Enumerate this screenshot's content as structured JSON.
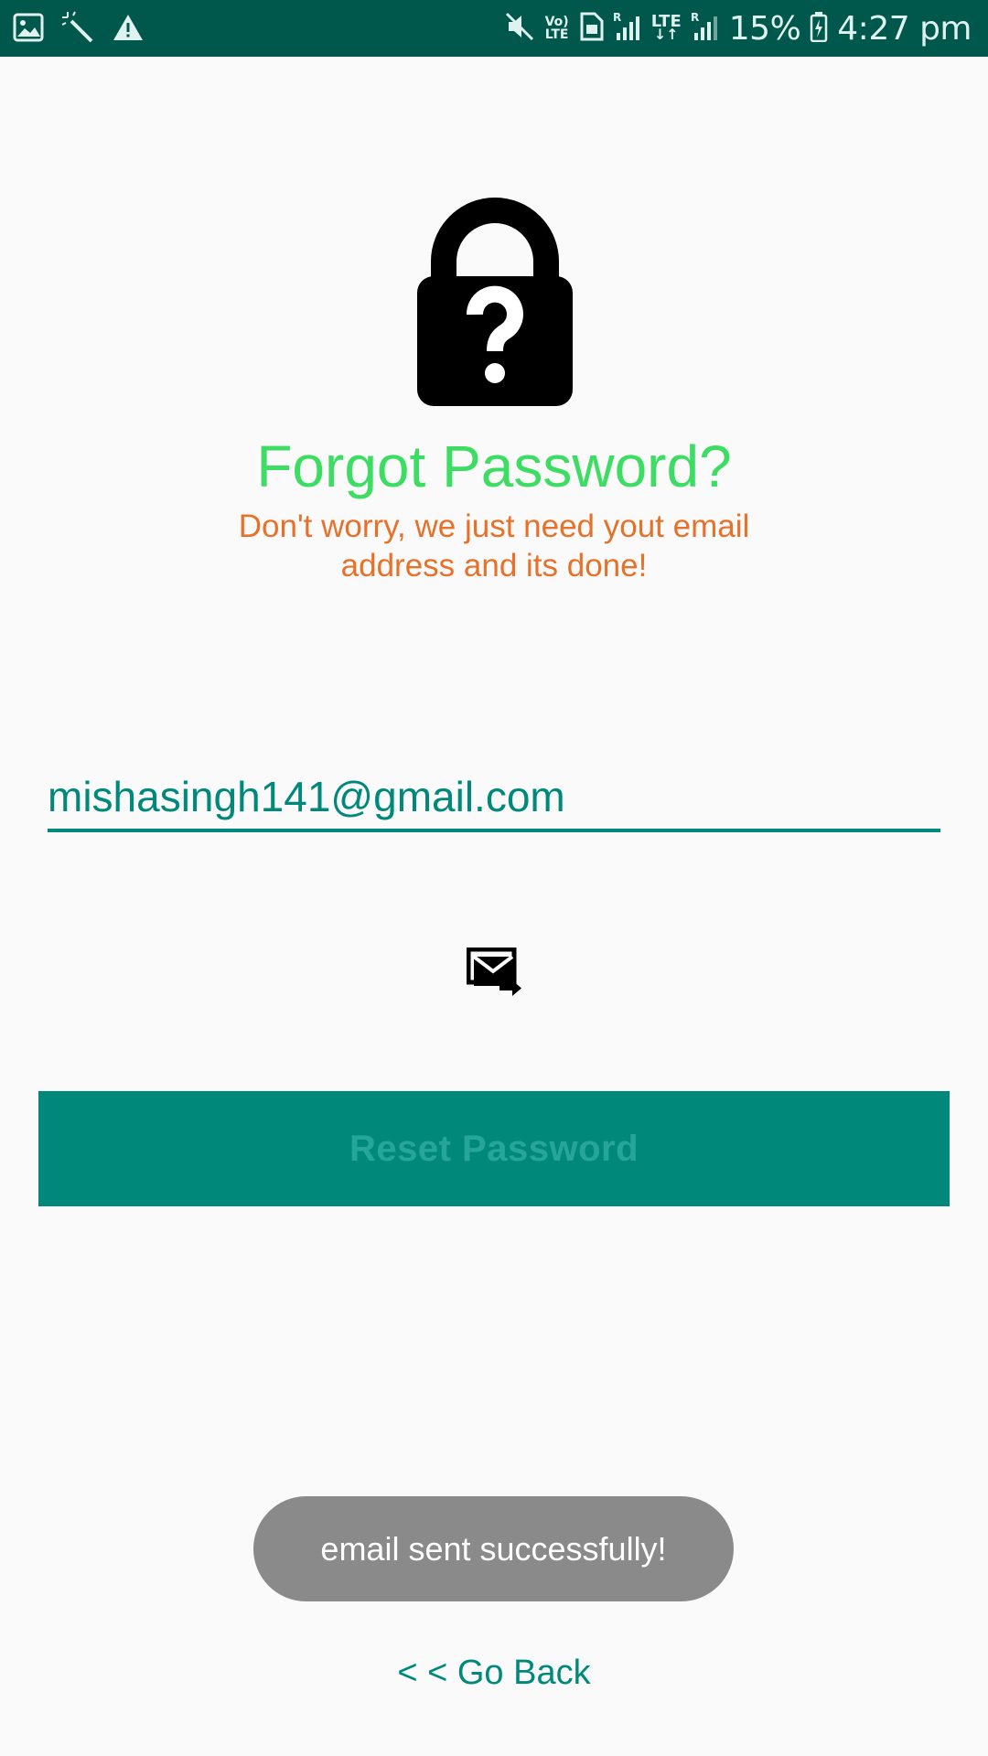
{
  "status_bar": {
    "left_icons": [
      "image-icon",
      "magic-wand-icon",
      "warning-icon"
    ],
    "right_icons": [
      "mute-icon",
      "volte-icon",
      "sim-card-icon",
      "signal-r-icon",
      "lte-data-icon",
      "signal-icon",
      "battery-charging-icon"
    ],
    "volte_top": "Vo)",
    "volte_bottom": "LTE",
    "lte_label": "LTE",
    "roaming_label": "R",
    "battery": "15%",
    "time": "4:27 pm"
  },
  "header": {
    "icon": "lock-question-icon",
    "title": "Forgot Password?",
    "subtitle": "Don't worry, we just need yout email address and its done!"
  },
  "form": {
    "email_value": "mishasingh141@gmail.com",
    "send_icon": "send-mail-icon",
    "reset_label": "Reset Password"
  },
  "toast": {
    "message": "email sent successfully!"
  },
  "footer": {
    "go_back_label": "< < Go Back"
  },
  "colors": {
    "status_bar": "#00574b",
    "accent": "#00897b",
    "title": "#3ddc63",
    "subtitle": "#e8712a",
    "toast": "#8a8a8a"
  }
}
